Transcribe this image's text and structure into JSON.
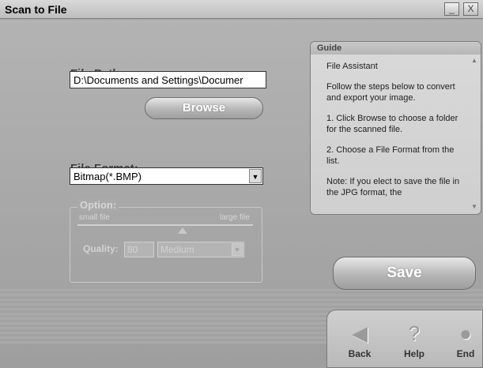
{
  "window": {
    "title": "Scan to File",
    "minimize_glyph": "_",
    "close_glyph": "X"
  },
  "file_path": {
    "label": "File Path:",
    "value": "D:\\Documents and Settings\\Documer",
    "browse_label": "Browse"
  },
  "file_format": {
    "label": "File Format:",
    "selected": "Bitmap(*.BMP)",
    "dropdown_glyph": "▼"
  },
  "option": {
    "title": "Option:",
    "small_file": "small file",
    "large_file": "large file",
    "quality_label": "Quality:",
    "quality_value": "80",
    "quality_level": "Medium",
    "dropdown_glyph": "▼"
  },
  "guide": {
    "header": "Guide",
    "lines": [
      "File Assistant",
      "Follow the steps below to convert and export your image.",
      "1. Click Browse to choose a folder for the scanned file.",
      "2. Choose a File Format from the list.",
      "Note: If you elect to save the file in the JPG format, the"
    ],
    "scroll_up_glyph": "▲",
    "scroll_down_glyph": "▼"
  },
  "save_label": "Save",
  "nav": {
    "back": {
      "label": "Back",
      "icon": "back-arrow-icon",
      "glyph": "◀"
    },
    "help": {
      "label": "Help",
      "icon": "question-icon",
      "glyph": "?"
    },
    "end": {
      "label": "End",
      "icon": "end-icon",
      "glyph": "●"
    }
  }
}
